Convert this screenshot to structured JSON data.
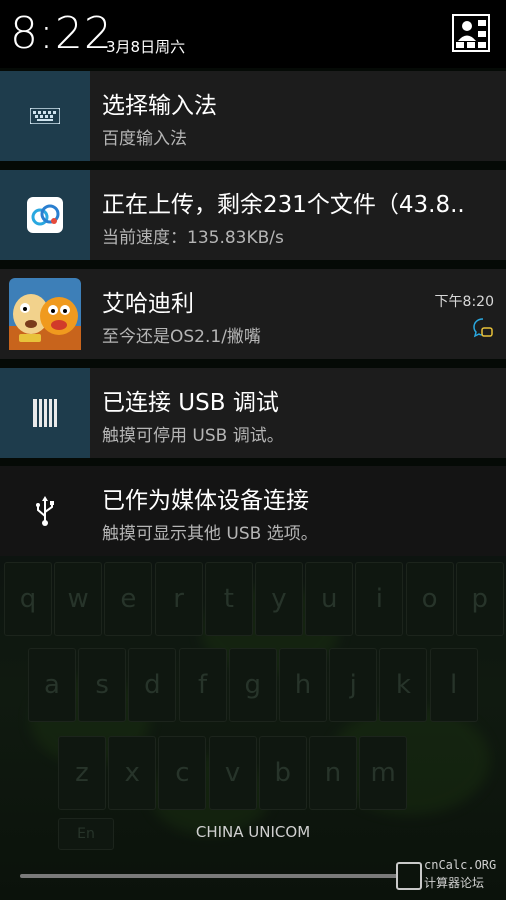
{
  "status": {
    "clock": "8:22",
    "date": "3月8日周六"
  },
  "notifications": [
    {
      "title": "选择输入法",
      "subtitle": "百度输入法",
      "icon": "keyboard-icon"
    },
    {
      "title": "正在上传，剩余231个文件（43.8..",
      "subtitle": "当前速度：135.83KB/s",
      "icon": "baidu-cloud-icon"
    },
    {
      "title": "艾哈迪利",
      "subtitle": "至今还是OS2.1/撇嘴",
      "time": "下午8:20",
      "icon": "garfield-avatar"
    },
    {
      "title": "已连接 USB 调试",
      "subtitle": "触摸可停用 USB 调试。",
      "icon": "usb-debug-icon"
    },
    {
      "title": "已作为媒体设备连接",
      "subtitle": "触摸可显示其他 USB 选项。",
      "icon": "usb-icon"
    }
  ],
  "keyboard": {
    "row1": [
      "q",
      "w",
      "e",
      "r",
      "t",
      "y",
      "u",
      "i",
      "o",
      "p"
    ],
    "row2": [
      "a",
      "s",
      "d",
      "f",
      "g",
      "h",
      "j",
      "k",
      "l"
    ],
    "row3": [
      "z",
      "x",
      "c",
      "v",
      "b",
      "n",
      "m"
    ],
    "row4_left": "En"
  },
  "carrier": "CHINA UNICOM",
  "watermark": {
    "line1": "cnCalc.ORG",
    "line2": "计算器论坛"
  },
  "colors": {
    "icon_tile": "#1e3c4c",
    "card_bg": "#1c1c1c",
    "accent_blue": "#2aa8e0"
  }
}
